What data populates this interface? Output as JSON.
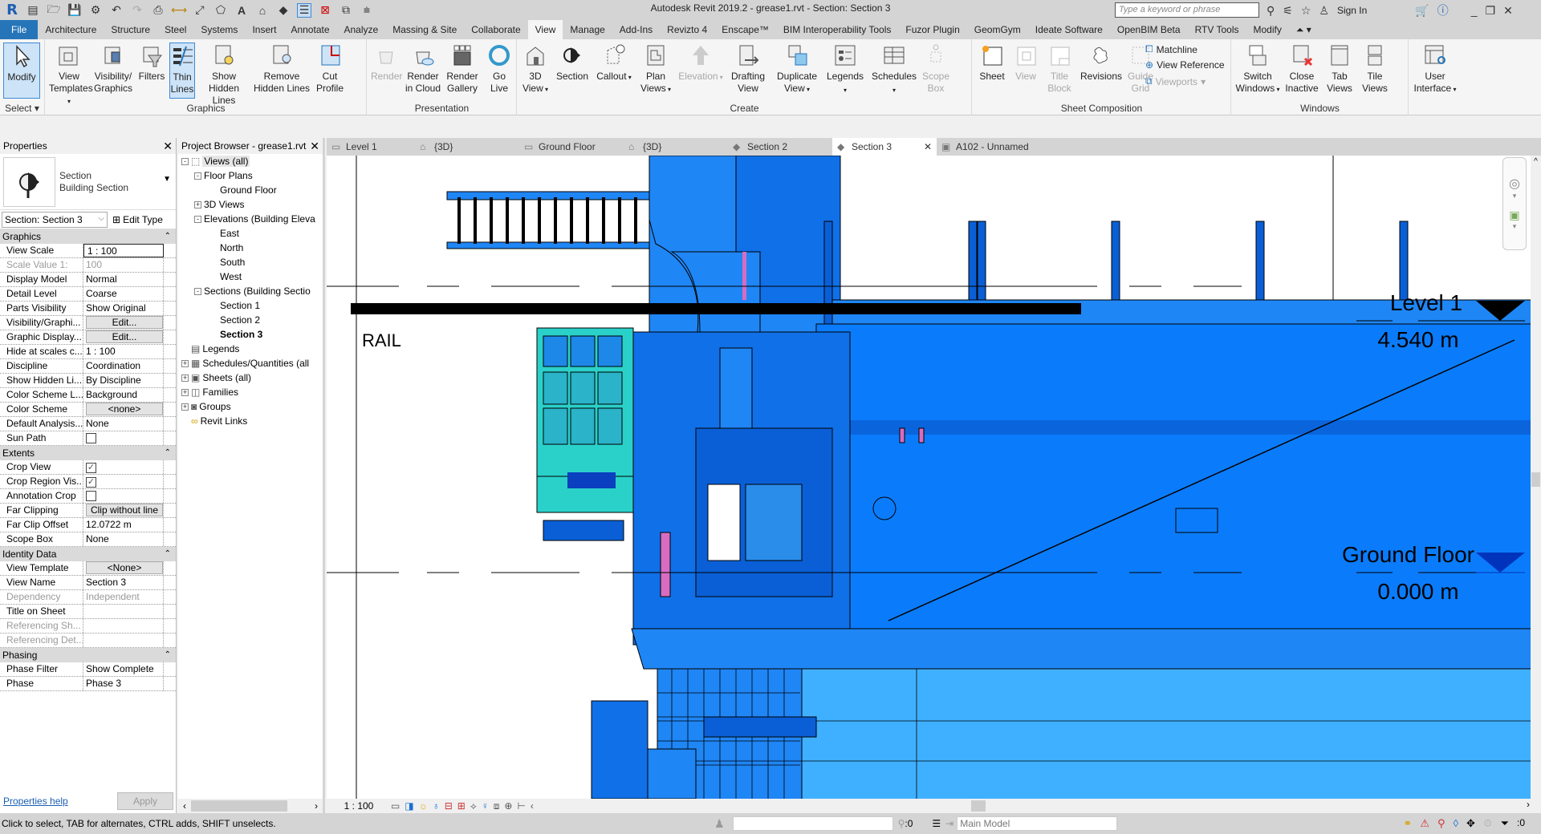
{
  "app": {
    "title": "Autodesk Revit 2019.2 - grease1.rvt - Section: Section 3",
    "search_placeholder": "Type a keyword or phrase",
    "sign_in": "Sign In"
  },
  "ribbon_tabs": [
    "File",
    "Architecture",
    "Structure",
    "Steel",
    "Systems",
    "Insert",
    "Annotate",
    "Analyze",
    "Massing & Site",
    "Collaborate",
    "View",
    "Manage",
    "Add-Ins",
    "Revizto 4",
    "Enscape™",
    "BIM Interoperability Tools",
    "Fuzor Plugin",
    "GeomGym",
    "Ideate Software",
    "OpenBIM Beta",
    "RTV Tools",
    "Modify"
  ],
  "active_tab": "View",
  "ribbon": {
    "select": {
      "title": "Select",
      "modify": "Modify"
    },
    "graphics": {
      "title": "Graphics",
      "buttons": [
        "View Templates",
        "Visibility/ Graphics",
        "Filters",
        "Thin Lines",
        "Show Hidden Lines",
        "Remove Hidden Lines",
        "Cut Profile"
      ]
    },
    "presentation": {
      "title": "Presentation",
      "buttons": [
        "Render",
        "Render in Cloud",
        "Render Gallery",
        "Go Live"
      ]
    },
    "create": {
      "title": "Create",
      "buttons": [
        "3D View",
        "Section",
        "Callout",
        "Plan Views",
        "Elevation",
        "Drafting View",
        "Duplicate View",
        "Legends",
        "Schedules",
        "Scope Box"
      ]
    },
    "sheet_composition": {
      "title": "Sheet Composition",
      "buttons": [
        "Sheet",
        "View",
        "Title Block",
        "Revisions",
        "Guide Grid"
      ],
      "small": [
        "Matchline",
        "View  Reference",
        "Viewports"
      ]
    },
    "windows": {
      "title": "Windows",
      "buttons": [
        "Switch Windows",
        "Close Inactive",
        "Tab Views",
        "Tile Views"
      ]
    },
    "ui": {
      "buttons": [
        "User Interface"
      ]
    }
  },
  "properties": {
    "title": "Properties",
    "type_family": "Section",
    "type_name": "Building Section",
    "instance": "Section: Section 3",
    "edit_type": "Edit Type",
    "groups": [
      {
        "name": "Graphics",
        "rows": [
          {
            "k": "View Scale",
            "v": "1 : 100",
            "kind": "input"
          },
          {
            "k": "Scale Value    1:",
            "v": "100",
            "kind": "dis"
          },
          {
            "k": "Display Model",
            "v": "Normal"
          },
          {
            "k": "Detail Level",
            "v": "Coarse"
          },
          {
            "k": "Parts Visibility",
            "v": "Show Original"
          },
          {
            "k": "Visibility/Graphi...",
            "v": "Edit...",
            "kind": "btn"
          },
          {
            "k": "Graphic Display...",
            "v": "Edit...",
            "kind": "btn"
          },
          {
            "k": "Hide at scales c...",
            "v": "1 : 100"
          },
          {
            "k": "Discipline",
            "v": "Coordination"
          },
          {
            "k": "Show Hidden Li...",
            "v": "By Discipline"
          },
          {
            "k": "Color Scheme L...",
            "v": "Background"
          },
          {
            "k": "Color Scheme",
            "v": "<none>",
            "kind": "btn"
          },
          {
            "k": "Default Analysis...",
            "v": "None"
          },
          {
            "k": "Sun Path",
            "v": "",
            "kind": "check",
            "checked": false
          }
        ]
      },
      {
        "name": "Extents",
        "rows": [
          {
            "k": "Crop View",
            "v": "",
            "kind": "check",
            "checked": true
          },
          {
            "k": "Crop Region Vis...",
            "v": "",
            "kind": "check",
            "checked": true
          },
          {
            "k": "Annotation Crop",
            "v": "",
            "kind": "check",
            "checked": false
          },
          {
            "k": "Far Clipping",
            "v": "Clip without line",
            "kind": "btn"
          },
          {
            "k": "Far Clip Offset",
            "v": "12.0722 m"
          },
          {
            "k": "Scope Box",
            "v": "None"
          }
        ]
      },
      {
        "name": "Identity Data",
        "rows": [
          {
            "k": "View Template",
            "v": "<None>",
            "kind": "btn"
          },
          {
            "k": "View Name",
            "v": "Section 3"
          },
          {
            "k": "Dependency",
            "v": "Independent",
            "kind": "dis"
          },
          {
            "k": "Title on Sheet",
            "v": ""
          },
          {
            "k": "Referencing Sh...",
            "v": "",
            "kind": "dis"
          },
          {
            "k": "Referencing Det...",
            "v": "",
            "kind": "dis"
          }
        ]
      },
      {
        "name": "Phasing",
        "rows": [
          {
            "k": "Phase Filter",
            "v": "Show Complete"
          },
          {
            "k": "Phase",
            "v": "Phase 3"
          }
        ]
      }
    ],
    "help": "Properties help",
    "apply": "Apply"
  },
  "browser": {
    "title": "Project Browser - grease1.rvt",
    "items": [
      {
        "label": "Views (all)",
        "level": 0,
        "toggle": "-",
        "sel": true
      },
      {
        "label": "Floor Plans",
        "level": 1,
        "toggle": "-"
      },
      {
        "label": "Ground Floor",
        "level": 2
      },
      {
        "label": "3D Views",
        "level": 1,
        "toggle": "+"
      },
      {
        "label": "Elevations (Building Eleva",
        "level": 1,
        "toggle": "-"
      },
      {
        "label": "East",
        "level": 2
      },
      {
        "label": "North",
        "level": 2
      },
      {
        "label": "South",
        "level": 2
      },
      {
        "label": "West",
        "level": 2
      },
      {
        "label": "Sections (Building Sectio",
        "level": 1,
        "toggle": "-"
      },
      {
        "label": "Section 1",
        "level": 2
      },
      {
        "label": "Section 2",
        "level": 2
      },
      {
        "label": "Section 3",
        "level": 2,
        "bold": true
      },
      {
        "label": "Legends",
        "level": 0,
        "icon": "▤"
      },
      {
        "label": "Schedules/Quantities (all",
        "level": 0,
        "toggle": "+",
        "icon": "▦"
      },
      {
        "label": "Sheets (all)",
        "level": 0,
        "toggle": "+",
        "icon": "▣"
      },
      {
        "label": "Families",
        "level": 0,
        "toggle": "+",
        "icon": "◫"
      },
      {
        "label": "Groups",
        "level": 0,
        "toggle": "+",
        "icon": "◙"
      },
      {
        "label": "Revit Links",
        "level": 0,
        "icon": "∞"
      }
    ]
  },
  "view_tabs": [
    {
      "label": "Level 1",
      "icon": "▭"
    },
    {
      "label": "{3D}",
      "icon": "⌂"
    },
    {
      "label": "Ground Floor",
      "icon": "▭"
    },
    {
      "label": "{3D}",
      "icon": "⌂"
    },
    {
      "label": "Section 2",
      "icon": "◆"
    },
    {
      "label": "Section 3",
      "icon": "◆",
      "active": true
    },
    {
      "label": "A102 - Unnamed",
      "icon": "▣"
    }
  ],
  "drawing": {
    "levels": [
      {
        "name": "Level 1",
        "elevation": "4.540 m",
        "color": "#000000"
      },
      {
        "name": "Ground Floor",
        "elevation": "0.000 m",
        "color": "#0033bb"
      }
    ],
    "annotation": "RAIL",
    "colors": {
      "dark": "#0a5fd6",
      "mid": "#1f86f5",
      "light": "#3fb0ff",
      "teal": "#2ad1c9",
      "pink": "#d86cc0"
    }
  },
  "viewbar": {
    "scale": "1 : 100"
  },
  "status": {
    "message": "Click to select, TAB for alternates, CTRL adds, SHIFT unselects.",
    "workset_count": ":0",
    "model": "Main Model",
    "filter_count": ":0"
  }
}
